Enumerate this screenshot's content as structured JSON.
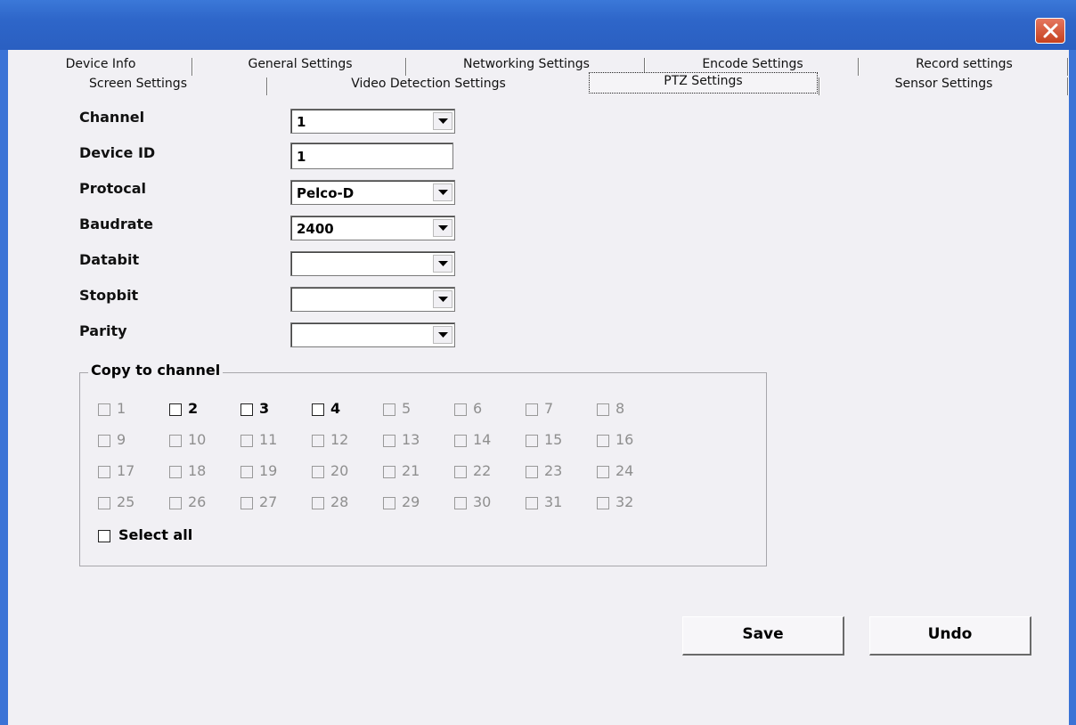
{
  "tabs_row1": [
    "Device Info",
    "General Settings",
    "Networking Settings",
    "Encode Settings",
    "Record settings"
  ],
  "tabs_row2": [
    "Screen Settings",
    "Video Detection Settings",
    "PTZ Settings",
    "Sensor Settings"
  ],
  "active_tab": "PTZ Settings",
  "form": {
    "channel_label": "Channel",
    "channel_value": "1",
    "device_id_label": "Device ID",
    "device_id_value": "1",
    "protocol_label": "Protocal",
    "protocol_value": "Pelco-D",
    "baudrate_label": "Baudrate",
    "baudrate_value": "2400",
    "databit_label": "Databit",
    "databit_value": "",
    "stopbit_label": "Stopbit",
    "stopbit_value": "",
    "parity_label": "Parity",
    "parity_value": ""
  },
  "copy": {
    "title": "Copy to channel",
    "channels": [
      "1",
      "2",
      "3",
      "4",
      "5",
      "6",
      "7",
      "8",
      "9",
      "10",
      "11",
      "12",
      "13",
      "14",
      "15",
      "16",
      "17",
      "18",
      "19",
      "20",
      "21",
      "22",
      "23",
      "24",
      "25",
      "26",
      "27",
      "28",
      "29",
      "30",
      "31",
      "32"
    ],
    "enabled_channels": [
      "2",
      "3",
      "4"
    ],
    "select_all_label": "Select all"
  },
  "buttons": {
    "save": "Save",
    "undo": "Undo"
  },
  "colors": {
    "titlebar": "#2e66c9",
    "close": "#d9532f",
    "client_bg": "#f1f0f4"
  },
  "icons": {
    "close": "close-icon",
    "dropdown": "chevron-down-icon"
  }
}
